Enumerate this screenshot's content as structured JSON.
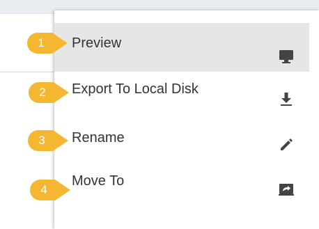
{
  "menu": {
    "items": [
      {
        "step": "1",
        "label": "Preview",
        "icon": "monitor-icon",
        "selected": true
      },
      {
        "step": "2",
        "label": "Export To Local Disk",
        "icon": "download-icon",
        "selected": false
      },
      {
        "step": "3",
        "label": "Rename",
        "icon": "pencil-icon",
        "selected": false
      },
      {
        "step": "4",
        "label": "Move To",
        "icon": "move-to-icon",
        "selected": false
      }
    ]
  },
  "colors": {
    "marker": "#f5b731",
    "selected_bg": "#e6e6e6",
    "icon": "#444444",
    "text": "#333333"
  }
}
